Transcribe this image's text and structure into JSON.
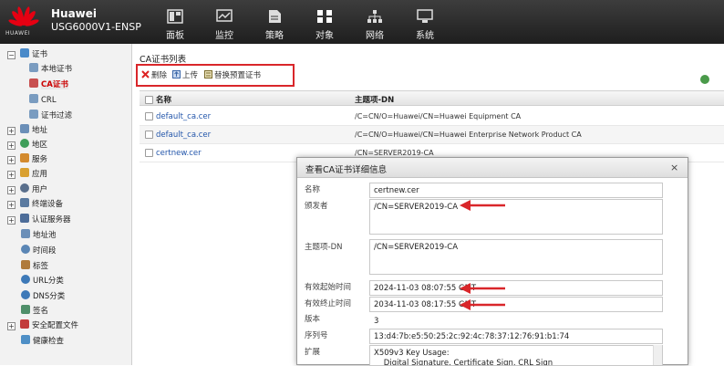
{
  "brand": {
    "name": "Huawei",
    "model": "USG6000V1-ENSP",
    "logo_text": "HUAWEI",
    "logo_color": "#e60012"
  },
  "nav": [
    {
      "label": "面板",
      "icon": "dashboard-icon"
    },
    {
      "label": "监控",
      "icon": "monitor-icon"
    },
    {
      "label": "策略",
      "icon": "policy-icon"
    },
    {
      "label": "对象",
      "icon": "object-icon"
    },
    {
      "label": "网络",
      "icon": "network-icon"
    },
    {
      "label": "系统",
      "icon": "system-icon"
    }
  ],
  "sidebar": {
    "items": [
      {
        "label": "证书",
        "expander": "⊟"
      },
      {
        "label": "本地证书"
      },
      {
        "label": "CA证书"
      },
      {
        "label": "CRL"
      },
      {
        "label": "证书过滤"
      },
      {
        "label": "地址",
        "expander": "+"
      },
      {
        "label": "地区",
        "expander": "+"
      },
      {
        "label": "服务",
        "expander": "+"
      },
      {
        "label": "应用",
        "expander": "+"
      },
      {
        "label": "用户",
        "expander": "+"
      },
      {
        "label": "终端设备",
        "expander": "+"
      },
      {
        "label": "认证服务器",
        "expander": "+"
      },
      {
        "label": "地址池"
      },
      {
        "label": "时间段"
      },
      {
        "label": "标签"
      },
      {
        "label": "URL分类"
      },
      {
        "label": "DNS分类"
      },
      {
        "label": "签名"
      },
      {
        "label": "安全配置文件",
        "expander": "+"
      },
      {
        "label": "健康检查"
      }
    ]
  },
  "main": {
    "title": "CA证书列表",
    "toolbar": {
      "delete": "删除",
      "upload": "上传",
      "replace": "替换预置证书"
    },
    "table": {
      "headers": [
        "名称",
        "主题项-DN"
      ],
      "rows": [
        {
          "name": "default_ca.cer",
          "subject": "/C=CN/O=Huawei/CN=Huawei Equipment CA"
        },
        {
          "name": "default_ca.cer",
          "subject": "/C=CN/O=Huawei/CN=Huawei Enterprise Network Product CA"
        },
        {
          "name": "certnew.cer",
          "subject": "/CN=SERVER2019-CA"
        }
      ]
    }
  },
  "dialog": {
    "title": "查看CA证书详细信息",
    "close": "×",
    "fields": {
      "name": {
        "label": "名称",
        "value": "certnew.cer"
      },
      "issuer": {
        "label": "颁发者",
        "value": "/CN=SERVER2019-CA"
      },
      "subject": {
        "label": "主题项-DN",
        "value": "/CN=SERVER2019-CA"
      },
      "valid_from": {
        "label": "有效起始时间",
        "value": "2024-11-03 08:07:55 GMT"
      },
      "valid_to": {
        "label": "有效终止时间",
        "value": "2034-11-03 08:17:55 GMT"
      },
      "version": {
        "label": "版本",
        "value": "3"
      },
      "serial": {
        "label": "序列号",
        "value": "13:d4:7b:e5:50:25:2c:92:4c:78:37:12:76:91:b1:74"
      },
      "extension": {
        "label": "扩展",
        "value": "X509v3 Key Usage:\n    Digital Signature, Certificate Sign, CRL Sign"
      }
    }
  },
  "colors": {
    "highlight_red": "#d9262a",
    "link_blue": "#2255aa",
    "selected_red": "#cc0000"
  }
}
